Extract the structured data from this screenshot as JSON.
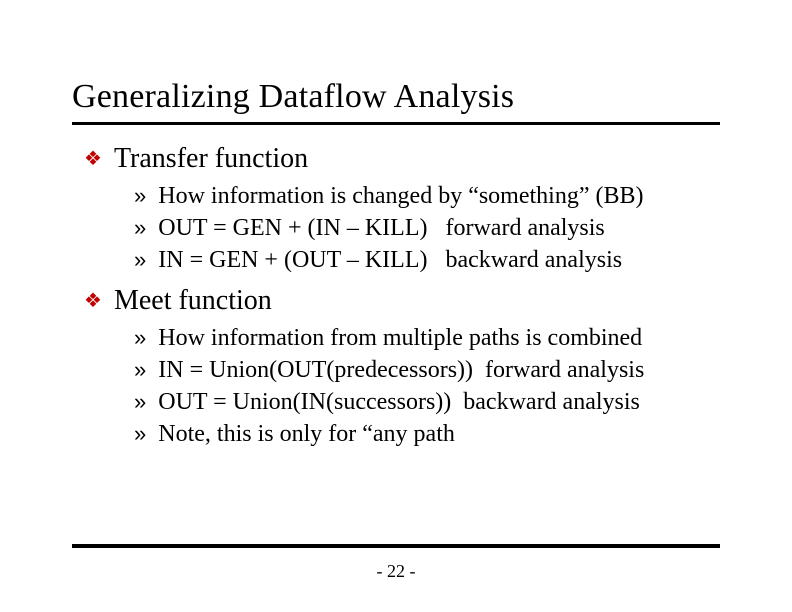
{
  "title": "Generalizing Dataflow Analysis",
  "sections": [
    {
      "heading": "Transfer function",
      "items": [
        "How information is changed by “something” (BB)",
        "OUT = GEN + (IN – KILL)   forward analysis",
        "IN = GEN + (OUT – KILL)   backward analysis"
      ]
    },
    {
      "heading": "Meet function",
      "items": [
        "How information from multiple paths is combined",
        "IN = Union(OUT(predecessors))  forward analysis",
        "OUT = Union(IN(successors))  backward analysis",
        "Note, this is only for “any path"
      ]
    }
  ],
  "page_number": "- 22 -"
}
